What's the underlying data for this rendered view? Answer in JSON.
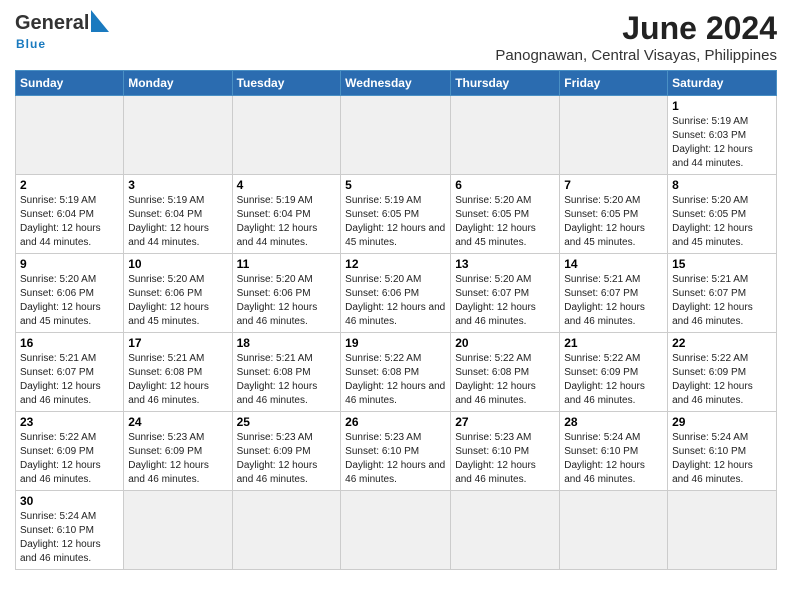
{
  "header": {
    "logo_general": "General",
    "logo_blue": "Blue",
    "title": "June 2024",
    "subtitle": "Panognawan, Central Visayas, Philippines"
  },
  "days_of_week": [
    "Sunday",
    "Monday",
    "Tuesday",
    "Wednesday",
    "Thursday",
    "Friday",
    "Saturday"
  ],
  "weeks": [
    [
      {
        "day": "",
        "info": "",
        "empty": true
      },
      {
        "day": "",
        "info": "",
        "empty": true
      },
      {
        "day": "",
        "info": "",
        "empty": true
      },
      {
        "day": "",
        "info": "",
        "empty": true
      },
      {
        "day": "",
        "info": "",
        "empty": true
      },
      {
        "day": "",
        "info": "",
        "empty": true
      },
      {
        "day": "1",
        "info": "Sunrise: 5:19 AM\nSunset: 6:03 PM\nDaylight: 12 hours and 44 minutes."
      }
    ],
    [
      {
        "day": "2",
        "info": "Sunrise: 5:19 AM\nSunset: 6:04 PM\nDaylight: 12 hours and 44 minutes."
      },
      {
        "day": "3",
        "info": "Sunrise: 5:19 AM\nSunset: 6:04 PM\nDaylight: 12 hours and 44 minutes."
      },
      {
        "day": "4",
        "info": "Sunrise: 5:19 AM\nSunset: 6:04 PM\nDaylight: 12 hours and 44 minutes."
      },
      {
        "day": "5",
        "info": "Sunrise: 5:19 AM\nSunset: 6:05 PM\nDaylight: 12 hours and 45 minutes."
      },
      {
        "day": "6",
        "info": "Sunrise: 5:20 AM\nSunset: 6:05 PM\nDaylight: 12 hours and 45 minutes."
      },
      {
        "day": "7",
        "info": "Sunrise: 5:20 AM\nSunset: 6:05 PM\nDaylight: 12 hours and 45 minutes."
      },
      {
        "day": "8",
        "info": "Sunrise: 5:20 AM\nSunset: 6:05 PM\nDaylight: 12 hours and 45 minutes."
      }
    ],
    [
      {
        "day": "9",
        "info": "Sunrise: 5:20 AM\nSunset: 6:06 PM\nDaylight: 12 hours and 45 minutes."
      },
      {
        "day": "10",
        "info": "Sunrise: 5:20 AM\nSunset: 6:06 PM\nDaylight: 12 hours and 45 minutes."
      },
      {
        "day": "11",
        "info": "Sunrise: 5:20 AM\nSunset: 6:06 PM\nDaylight: 12 hours and 46 minutes."
      },
      {
        "day": "12",
        "info": "Sunrise: 5:20 AM\nSunset: 6:06 PM\nDaylight: 12 hours and 46 minutes."
      },
      {
        "day": "13",
        "info": "Sunrise: 5:20 AM\nSunset: 6:07 PM\nDaylight: 12 hours and 46 minutes."
      },
      {
        "day": "14",
        "info": "Sunrise: 5:21 AM\nSunset: 6:07 PM\nDaylight: 12 hours and 46 minutes."
      },
      {
        "day": "15",
        "info": "Sunrise: 5:21 AM\nSunset: 6:07 PM\nDaylight: 12 hours and 46 minutes."
      }
    ],
    [
      {
        "day": "16",
        "info": "Sunrise: 5:21 AM\nSunset: 6:07 PM\nDaylight: 12 hours and 46 minutes."
      },
      {
        "day": "17",
        "info": "Sunrise: 5:21 AM\nSunset: 6:08 PM\nDaylight: 12 hours and 46 minutes."
      },
      {
        "day": "18",
        "info": "Sunrise: 5:21 AM\nSunset: 6:08 PM\nDaylight: 12 hours and 46 minutes."
      },
      {
        "day": "19",
        "info": "Sunrise: 5:22 AM\nSunset: 6:08 PM\nDaylight: 12 hours and 46 minutes."
      },
      {
        "day": "20",
        "info": "Sunrise: 5:22 AM\nSunset: 6:08 PM\nDaylight: 12 hours and 46 minutes."
      },
      {
        "day": "21",
        "info": "Sunrise: 5:22 AM\nSunset: 6:09 PM\nDaylight: 12 hours and 46 minutes."
      },
      {
        "day": "22",
        "info": "Sunrise: 5:22 AM\nSunset: 6:09 PM\nDaylight: 12 hours and 46 minutes."
      }
    ],
    [
      {
        "day": "23",
        "info": "Sunrise: 5:22 AM\nSunset: 6:09 PM\nDaylight: 12 hours and 46 minutes."
      },
      {
        "day": "24",
        "info": "Sunrise: 5:23 AM\nSunset: 6:09 PM\nDaylight: 12 hours and 46 minutes."
      },
      {
        "day": "25",
        "info": "Sunrise: 5:23 AM\nSunset: 6:09 PM\nDaylight: 12 hours and 46 minutes."
      },
      {
        "day": "26",
        "info": "Sunrise: 5:23 AM\nSunset: 6:10 PM\nDaylight: 12 hours and 46 minutes."
      },
      {
        "day": "27",
        "info": "Sunrise: 5:23 AM\nSunset: 6:10 PM\nDaylight: 12 hours and 46 minutes."
      },
      {
        "day": "28",
        "info": "Sunrise: 5:24 AM\nSunset: 6:10 PM\nDaylight: 12 hours and 46 minutes."
      },
      {
        "day": "29",
        "info": "Sunrise: 5:24 AM\nSunset: 6:10 PM\nDaylight: 12 hours and 46 minutes."
      }
    ],
    [
      {
        "day": "30",
        "info": "Sunrise: 5:24 AM\nSunset: 6:10 PM\nDaylight: 12 hours and 46 minutes."
      },
      {
        "day": "",
        "info": "",
        "empty": true
      },
      {
        "day": "",
        "info": "",
        "empty": true
      },
      {
        "day": "",
        "info": "",
        "empty": true
      },
      {
        "day": "",
        "info": "",
        "empty": true
      },
      {
        "day": "",
        "info": "",
        "empty": true
      },
      {
        "day": "",
        "info": "",
        "empty": true
      }
    ]
  ]
}
